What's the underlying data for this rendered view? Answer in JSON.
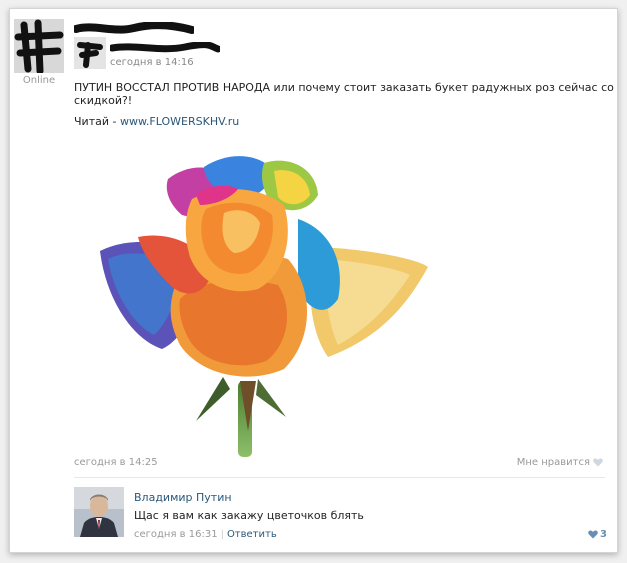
{
  "post": {
    "status": "Online",
    "date": "сегодня в 14:16",
    "text": "ПУТИН ВОССТАЛ ПРОТИВ НАРОДА или почему стоит заказать букет радужных роз сейчас со скидкой?!",
    "read_prefix": "Читай - ",
    "read_link": "www.FLOWERSKHV.ru",
    "footer_date": "сегодня в 14:25",
    "like_label": "Мне нравится"
  },
  "comment": {
    "author": "Владимир Путин",
    "text": "Щас я вам как закажу цветочков блять",
    "date": "сегодня в 16:31",
    "reply_label": "Ответить",
    "likes": "3"
  },
  "icons": {
    "like": "heart-icon",
    "comment_like": "heart-icon"
  },
  "colors": {
    "link": "#2b587a",
    "muted": "#999999"
  }
}
